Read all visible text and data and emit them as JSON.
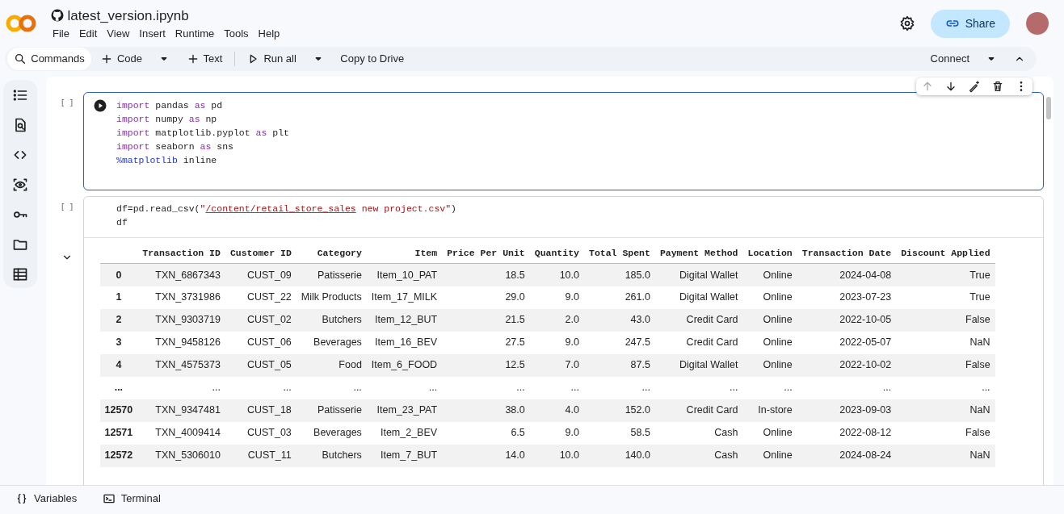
{
  "header": {
    "notebook_title": "latest_version.ipynb",
    "menu": [
      "File",
      "Edit",
      "View",
      "Insert",
      "Runtime",
      "Tools",
      "Help"
    ],
    "share_label": "Share"
  },
  "toolbar": {
    "items": [
      {
        "kind": "search",
        "label": "Commands"
      },
      {
        "kind": "add",
        "label": "Code"
      },
      {
        "kind": "caret"
      },
      {
        "kind": "add",
        "label": "Text"
      },
      {
        "kind": "divider"
      },
      {
        "kind": "run",
        "label": "Run all"
      },
      {
        "kind": "caret"
      },
      {
        "kind": "plain",
        "label": "Copy to Drive"
      }
    ],
    "connect_label": "Connect"
  },
  "sidebar": {
    "items": [
      {
        "kind": "toc"
      },
      {
        "kind": "find"
      },
      {
        "kind": "code"
      },
      {
        "kind": "eye"
      },
      {
        "kind": "key"
      },
      {
        "kind": "folder"
      },
      {
        "kind": "table"
      }
    ]
  },
  "cells": [
    {
      "prompt": "[ ]",
      "focused": true,
      "lines": [
        [
          {
            "kind": "kw",
            "text": "import"
          },
          {
            "kind": "plain",
            "text": " pandas "
          },
          {
            "kind": "kw",
            "text": "as"
          },
          {
            "kind": "plain",
            "text": " pd"
          }
        ],
        [
          {
            "kind": "kw",
            "text": "import"
          },
          {
            "kind": "plain",
            "text": " numpy "
          },
          {
            "kind": "kw",
            "text": "as"
          },
          {
            "kind": "plain",
            "text": " np"
          }
        ],
        [
          {
            "kind": "kw",
            "text": "import"
          },
          {
            "kind": "plain",
            "text": " matplotlib.pyplot "
          },
          {
            "kind": "kw",
            "text": "as"
          },
          {
            "kind": "plain",
            "text": " plt"
          }
        ],
        [
          {
            "kind": "kw",
            "text": "import"
          },
          {
            "kind": "plain",
            "text": " seaborn "
          },
          {
            "kind": "kw",
            "text": "as"
          },
          {
            "kind": "plain",
            "text": " sns"
          }
        ],
        [
          {
            "kind": "magic",
            "text": "%matplotlib"
          },
          {
            "kind": "plain",
            "text": " inline"
          }
        ]
      ]
    },
    {
      "prompt": "[ ]",
      "focused": false,
      "lines": [
        [
          {
            "kind": "plain",
            "text": "df=pd.read_csv("
          },
          {
            "kind": "str",
            "text": "\""
          },
          {
            "kind": "strpath",
            "text": "/content/retail_store_sales"
          },
          {
            "kind": "str",
            "text": " new project.csv\""
          },
          {
            "kind": "plain",
            "text": ")"
          }
        ],
        [
          {
            "kind": "plain",
            "text": "df"
          }
        ]
      ],
      "output": {
        "expanded": true,
        "columns": [
          "Transaction ID",
          "Customer ID",
          "Category",
          "Item",
          "Price Per Unit",
          "Quantity",
          "Total Spent",
          "Payment Method",
          "Location",
          "Transaction Date",
          "Discount Applied"
        ],
        "rows": [
          {
            "index": "0",
            "cells": [
              "TXN_6867343",
              "CUST_09",
              "Patisserie",
              "Item_10_PAT",
              "18.5",
              "10.0",
              "185.0",
              "Digital Wallet",
              "Online",
              "2024-04-08",
              "True"
            ]
          },
          {
            "index": "1",
            "cells": [
              "TXN_3731986",
              "CUST_22",
              "Milk Products",
              "Item_17_MILK",
              "29.0",
              "9.0",
              "261.0",
              "Digital Wallet",
              "Online",
              "2023-07-23",
              "True"
            ]
          },
          {
            "index": "2",
            "cells": [
              "TXN_9303719",
              "CUST_02",
              "Butchers",
              "Item_12_BUT",
              "21.5",
              "2.0",
              "43.0",
              "Credit Card",
              "Online",
              "2022-10-05",
              "False"
            ]
          },
          {
            "index": "3",
            "cells": [
              "TXN_9458126",
              "CUST_06",
              "Beverages",
              "Item_16_BEV",
              "27.5",
              "9.0",
              "247.5",
              "Credit Card",
              "Online",
              "2022-05-07",
              "NaN"
            ]
          },
          {
            "index": "4",
            "cells": [
              "TXN_4575373",
              "CUST_05",
              "Food",
              "Item_6_FOOD",
              "12.5",
              "7.0",
              "87.5",
              "Digital Wallet",
              "Online",
              "2022-10-02",
              "False"
            ]
          },
          {
            "index": "...",
            "cells": [
              "...",
              "...",
              "...",
              "...",
              "...",
              "...",
              "...",
              "...",
              "...",
              "...",
              "..."
            ]
          },
          {
            "index": "12570",
            "cells": [
              "TXN_9347481",
              "CUST_18",
              "Patisserie",
              "Item_23_PAT",
              "38.0",
              "4.0",
              "152.0",
              "Credit Card",
              "In-store",
              "2023-09-03",
              "NaN"
            ]
          },
          {
            "index": "12571",
            "cells": [
              "TXN_4009414",
              "CUST_03",
              "Beverages",
              "Item_2_BEV",
              "6.5",
              "9.0",
              "58.5",
              "Cash",
              "Online",
              "2022-08-12",
              "False"
            ]
          },
          {
            "index": "12572",
            "cells": [
              "TXN_5306010",
              "CUST_11",
              "Butchers",
              "Item_7_BUT",
              "14.0",
              "10.0",
              "140.0",
              "Cash",
              "Online",
              "2024-08-24",
              "NaN"
            ]
          }
        ]
      }
    }
  ],
  "bottom_bar": [
    {
      "kind": "variables",
      "label": "Variables"
    },
    {
      "kind": "terminal",
      "label": "Terminal"
    }
  ]
}
